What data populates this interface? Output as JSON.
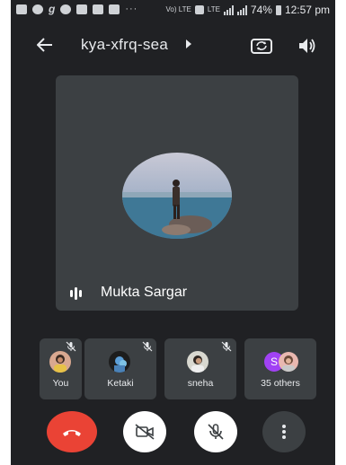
{
  "status_bar": {
    "battery_text": "74%",
    "time": "12:57 pm",
    "dots": "···",
    "volte_label": "Vo) LTE",
    "lte_label": "LTE"
  },
  "top_bar": {
    "meeting_code": "kya-xfrq-sea",
    "icons": [
      "back-arrow-icon",
      "caret-right-icon",
      "switch-camera-icon",
      "speaker-icon"
    ]
  },
  "main_tile": {
    "name": "Mukta Sargar",
    "speaking": true
  },
  "participants": [
    {
      "name": "You",
      "muted": true
    },
    {
      "name": "Ketaki",
      "muted": true
    },
    {
      "name": "sneha",
      "muted": true
    },
    {
      "name": "35 others",
      "avatar_letter": "S",
      "avatar_color": "#a142f4"
    }
  ],
  "controls": {
    "end_color": "#ea4335",
    "buttons": [
      "end-call",
      "camera-off",
      "mic-off",
      "more-options"
    ]
  },
  "colors": {
    "background": "#202124",
    "tile": "#3c4043",
    "text": "#e8eaed"
  }
}
